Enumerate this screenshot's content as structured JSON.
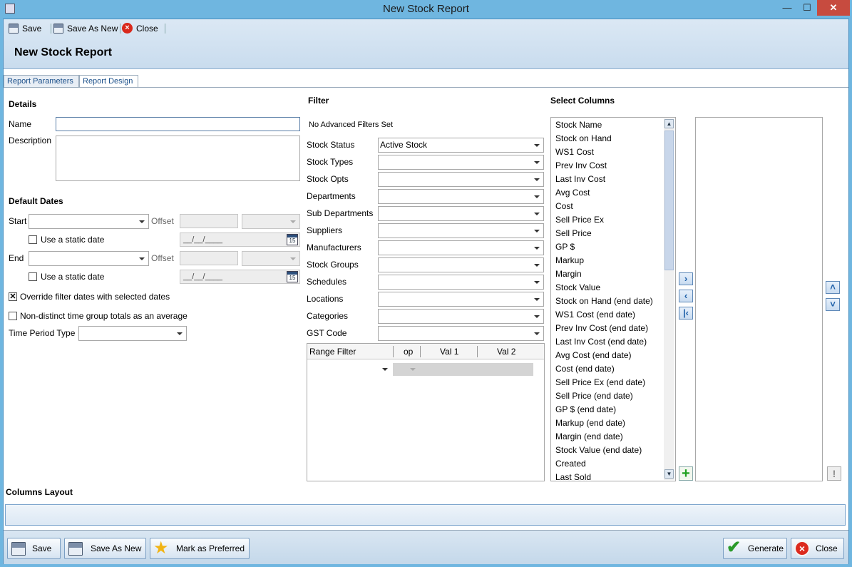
{
  "window": {
    "title": "New Stock Report"
  },
  "toolbar": {
    "save": "Save",
    "save_as_new": "Save As New",
    "close": "Close"
  },
  "page_title": "New Stock Report",
  "tabs": [
    "Report Parameters",
    "Report Design"
  ],
  "details": {
    "header": "Details",
    "name_label": "Name",
    "description_label": "Description"
  },
  "default_dates": {
    "header": "Default Dates",
    "start_label": "Start",
    "end_label": "End",
    "offset_label": "Offset",
    "static_date_label": "Use a static date",
    "date_mask": "__/__/____",
    "calendar_day": "15",
    "override_label": "Override filter dates with selected dates",
    "override_checked": "✕",
    "non_distinct_label": "Non-distinct time group totals as an average",
    "time_period_label": "Time Period Type"
  },
  "filter": {
    "header": "Filter",
    "advanced_status": "No Advanced Filters Set",
    "rows": [
      {
        "label": "Stock Status",
        "value": "Active Stock"
      },
      {
        "label": "Stock Types",
        "value": ""
      },
      {
        "label": "Stock Opts",
        "value": ""
      },
      {
        "label": "Departments",
        "value": ""
      },
      {
        "label": "Sub Departments",
        "value": ""
      },
      {
        "label": "Suppliers",
        "value": ""
      },
      {
        "label": "Manufacturers",
        "value": ""
      },
      {
        "label": "Stock Groups",
        "value": ""
      },
      {
        "label": "Schedules",
        "value": ""
      },
      {
        "label": "Locations",
        "value": ""
      },
      {
        "label": "Categories",
        "value": ""
      },
      {
        "label": "GST Code",
        "value": ""
      }
    ],
    "range_columns": [
      "Range Filter",
      "op",
      "Val 1",
      "Val 2"
    ]
  },
  "select_columns": {
    "header": "Select Columns",
    "available": [
      "Stock Name",
      "Stock on Hand",
      "WS1 Cost",
      "Prev Inv Cost",
      "Last Inv Cost",
      "Avg Cost",
      "Cost",
      "Sell Price Ex",
      "Sell Price",
      "GP $",
      "Markup",
      "Margin",
      "Stock Value",
      "Stock on Hand (end date)",
      "WS1 Cost (end date)",
      "Prev Inv Cost (end date)",
      "Last Inv Cost (end date)",
      "Avg Cost (end date)",
      "Cost (end date)",
      "Sell Price Ex (end date)",
      "Sell Price (end date)",
      "GP $ (end date)",
      "Markup (end date)",
      "Margin (end date)",
      "Stock Value (end date)",
      "Created",
      "Last Sold"
    ]
  },
  "columns_layout": {
    "header": "Columns Layout"
  },
  "bottom": {
    "save": "Save",
    "save_as_new": "Save As New",
    "mark_preferred": "Mark as Preferred",
    "generate": "Generate",
    "close": "Close"
  },
  "icons": {
    "add_column": "plus-icon",
    "move_right": "chevron-right-icon",
    "move_left": "chevron-left-icon",
    "move_all_left": "double-chevron-left-icon",
    "move_up": "chevron-up-icon",
    "move_down": "chevron-down-icon",
    "warning": "exclamation-icon"
  },
  "colors": {
    "title_bar": "#6fb6e0",
    "toolbar": "#d5e3f1",
    "accent_link": "#1a4f8a"
  }
}
